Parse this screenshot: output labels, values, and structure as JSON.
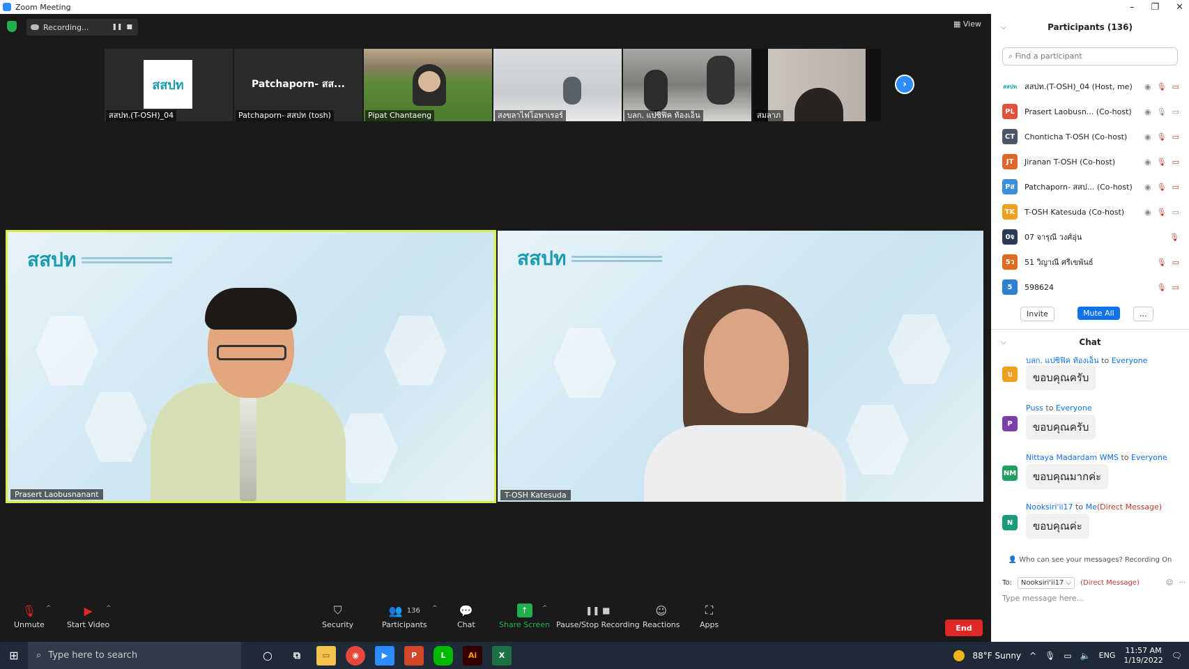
{
  "window": {
    "title": "Zoom Meeting"
  },
  "top": {
    "recording": "Recording...",
    "view": "View"
  },
  "gallery": [
    {
      "name": "สสปท.(T-OSH)_04",
      "type": "logo"
    },
    {
      "name": "Patchaporn- สสปท (tosh)",
      "big": "Patchaporn- สส..."
    },
    {
      "name": "Pipat Chantaeng",
      "type": "video"
    },
    {
      "name": "สงขลาไฟโอพาเรอร์",
      "type": "video"
    },
    {
      "name": "บลก. แปซิฟิค ท้องเอ็น",
      "type": "video"
    },
    {
      "name": "สมลาภ",
      "type": "video"
    }
  ],
  "speakers": [
    {
      "name": "Prasert Laobusnanant",
      "brand": "สสปท"
    },
    {
      "name": "T-OSH Katesuda",
      "brand": "สสปท"
    }
  ],
  "toolbar": {
    "unmute": "Unmute",
    "start_video": "Start Video",
    "security": "Security",
    "participants": "Participants",
    "participants_count": "136",
    "chat": "Chat",
    "share_screen": "Share Screen",
    "pause_stop": "Pause/Stop Recording",
    "reactions": "Reactions",
    "apps": "Apps",
    "end": "End"
  },
  "participants_panel": {
    "title": "Participants (136)",
    "search_placeholder": "Find a participant",
    "list": [
      {
        "initials": "สสปท",
        "name": "สสปท.(T-OSH)_04 (Host, me)",
        "color": "#ffffff"
      },
      {
        "initials": "PL",
        "name": "Prasert Laobusn... (Co-host)",
        "color": "#e0523a"
      },
      {
        "initials": "CT",
        "name": "Chonticha T-OSH (Co-host)",
        "color": "#4a5568"
      },
      {
        "initials": "JT",
        "name": "Jiranan T-OSH (Co-host)",
        "color": "#e0672a"
      },
      {
        "initials": "Pส",
        "name": "Patchaporn- สสป... (Co-host)",
        "color": "#3a8fd8"
      },
      {
        "initials": "TK",
        "name": "T-OSH Katesuda (Co-host)",
        "color": "#f0a020"
      },
      {
        "initials": "0จ",
        "name": "07 จารุณี วงศ์อุ่น",
        "color": "#2b3a55"
      },
      {
        "initials": "5ว",
        "name": "51 วิญาณี ศรีเขพันธ์",
        "color": "#e06a20"
      },
      {
        "initials": "5",
        "name": "598624",
        "color": "#2f80d0"
      }
    ],
    "invite": "Invite",
    "mute_all": "Mute All",
    "more": "..."
  },
  "chat_panel": {
    "title": "Chat",
    "messages": [
      {
        "initial": "บ",
        "color": "#f0a020",
        "from": "บลก. แปซิฟิค ท้องเอ็น",
        "to_word": "to",
        "to": "Everyone",
        "dm": "",
        "text": "ขอบคุณครับ"
      },
      {
        "initial": "P",
        "color": "#7b3fa8",
        "from": "Puss",
        "to_word": "to",
        "to": "Everyone",
        "dm": "",
        "text": "ขอบคุณครับ"
      },
      {
        "initial": "NM",
        "color": "#20a060",
        "from": "Nittaya Madardam WMS",
        "to_word": "to",
        "to": "Everyone",
        "dm": "",
        "text": "ขอบคุณมากค่ะ"
      },
      {
        "initial": "N",
        "color": "#1a9a7a",
        "from": "Nooksiri'ii17",
        "to_word": "to",
        "to": "Me",
        "dm": "(Direct Message)",
        "text": "ขอบคุณค่ะ"
      }
    ],
    "who_can_see": "Who can see your messages? Recording On",
    "to_label": "To:",
    "to_value": "Nooksiri'ii17",
    "to_dm": "(Direct Message)",
    "type_placeholder": "Type message here..."
  },
  "taskbar": {
    "search": "Type here to search",
    "weather": "88°F  Sunny",
    "lang": "ENG",
    "time": "11:57 AM",
    "date": "1/19/2022"
  }
}
